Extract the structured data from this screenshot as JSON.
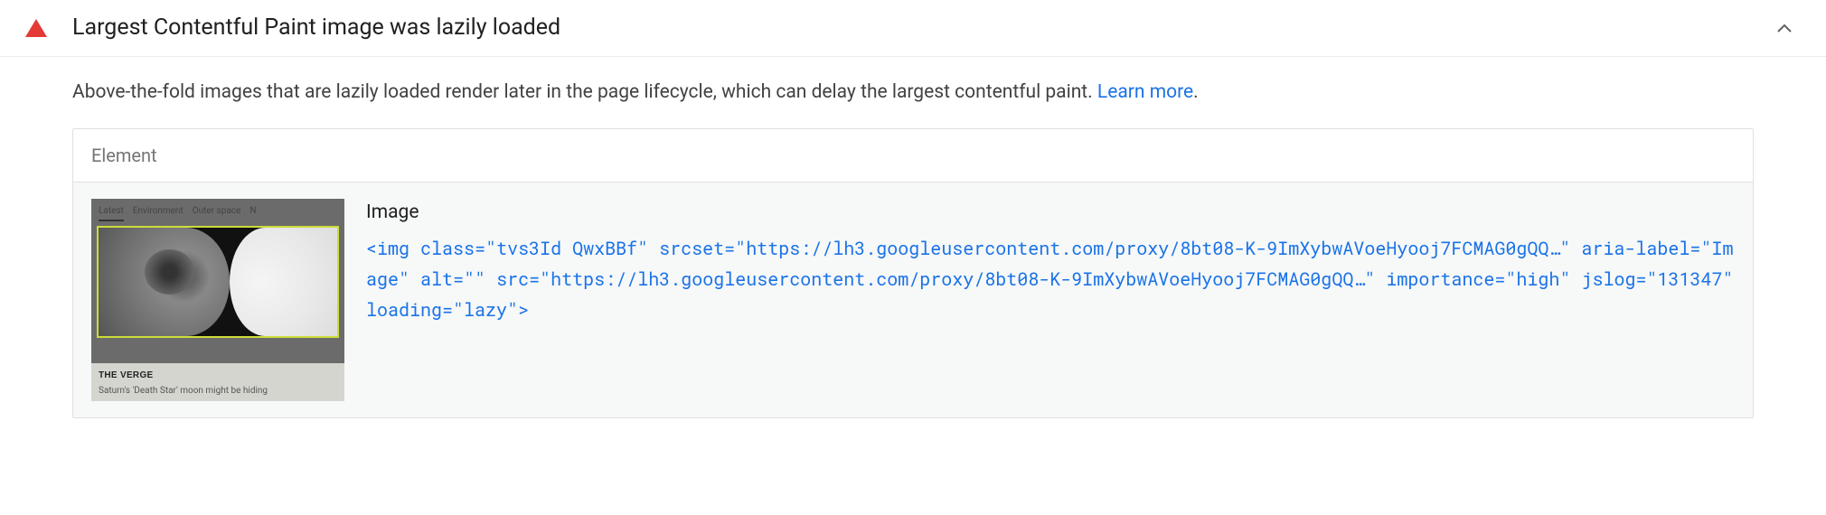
{
  "audit": {
    "title": "Largest Contentful Paint image was lazily loaded",
    "description_prefix": "Above-the-fold images that are lazily loaded render later in the page lifecycle, which can delay the largest contentful paint. ",
    "learn_more_label": "Learn more",
    "description_suffix": "."
  },
  "table": {
    "header": "Element",
    "row": {
      "thumbnail": {
        "tabs": [
          "Latest",
          "Environment",
          "Outer space",
          "N"
        ],
        "brand": "THE VERGE",
        "caption": "Saturn's 'Death Star' moon might be hiding"
      },
      "element_label": "Image",
      "code": {
        "tag": "img",
        "attrs": [
          {
            "name": "class",
            "value": "tvs3Id QwxBBf"
          },
          {
            "name": "srcset",
            "value": "https://lh3.googleusercontent.com/proxy/8bt08-K-9ImXybwAVoeHyooj7FCMAG0gQQ…"
          },
          {
            "name": "aria-label",
            "value": "Image"
          },
          {
            "name": "alt",
            "value": ""
          },
          {
            "name": "src",
            "value": "https://lh3.googleusercontent.com/proxy/8bt08-K-9ImXybwAVoeHyooj7FCMAG0gQQ…"
          },
          {
            "name": "importance",
            "value": "high"
          },
          {
            "name": "jslog",
            "value": "131347"
          },
          {
            "name": "loading",
            "value": "lazy"
          }
        ]
      }
    }
  }
}
